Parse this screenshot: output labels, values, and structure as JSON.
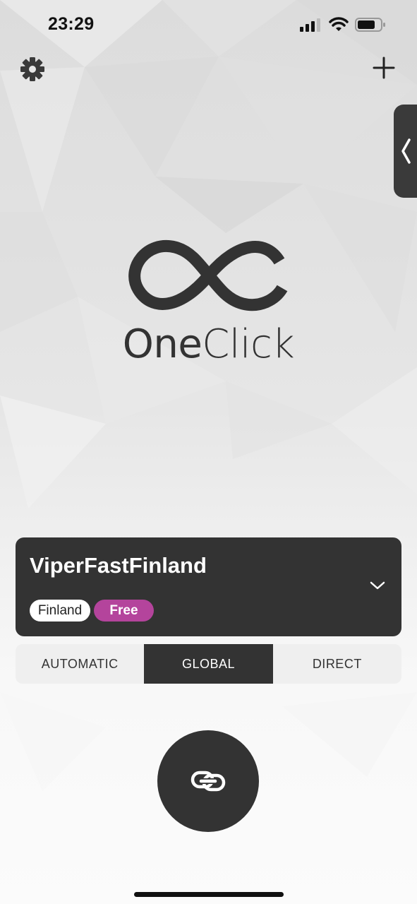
{
  "status_bar": {
    "time": "23:29",
    "icons": [
      "signal-icon",
      "wifi-icon",
      "battery-icon"
    ]
  },
  "header": {
    "left_icon": "gear-icon",
    "right_icon": "plus-icon"
  },
  "side_tab": {
    "icon": "chevron-left-icon"
  },
  "logo": {
    "icon": "infinity-icon",
    "text_part1": "One",
    "text_part2": "Click"
  },
  "server": {
    "name": "ViperFastFinland",
    "country": "Finland",
    "plan": "Free",
    "icon": "chevron-down-icon"
  },
  "modes": {
    "items": [
      "AUTOMATIC",
      "GLOBAL",
      "DIRECT"
    ],
    "selected": "GLOBAL"
  },
  "connect": {
    "icon": "link-icon"
  },
  "colors": {
    "dark": "#333333",
    "accent": "#b4449c",
    "background": "#fafafa"
  }
}
